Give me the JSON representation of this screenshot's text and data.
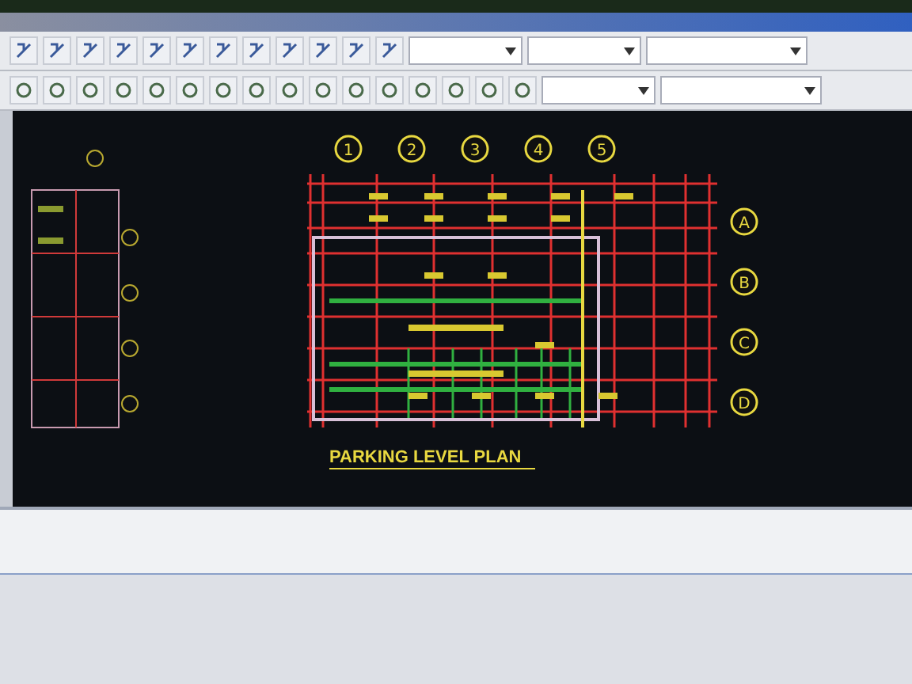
{
  "plan": {
    "column_grid": [
      "1",
      "2",
      "3",
      "4",
      "5"
    ],
    "row_grid": [
      "A",
      "B",
      "C",
      "D"
    ],
    "title": "PARKING LEVEL PLAN"
  }
}
